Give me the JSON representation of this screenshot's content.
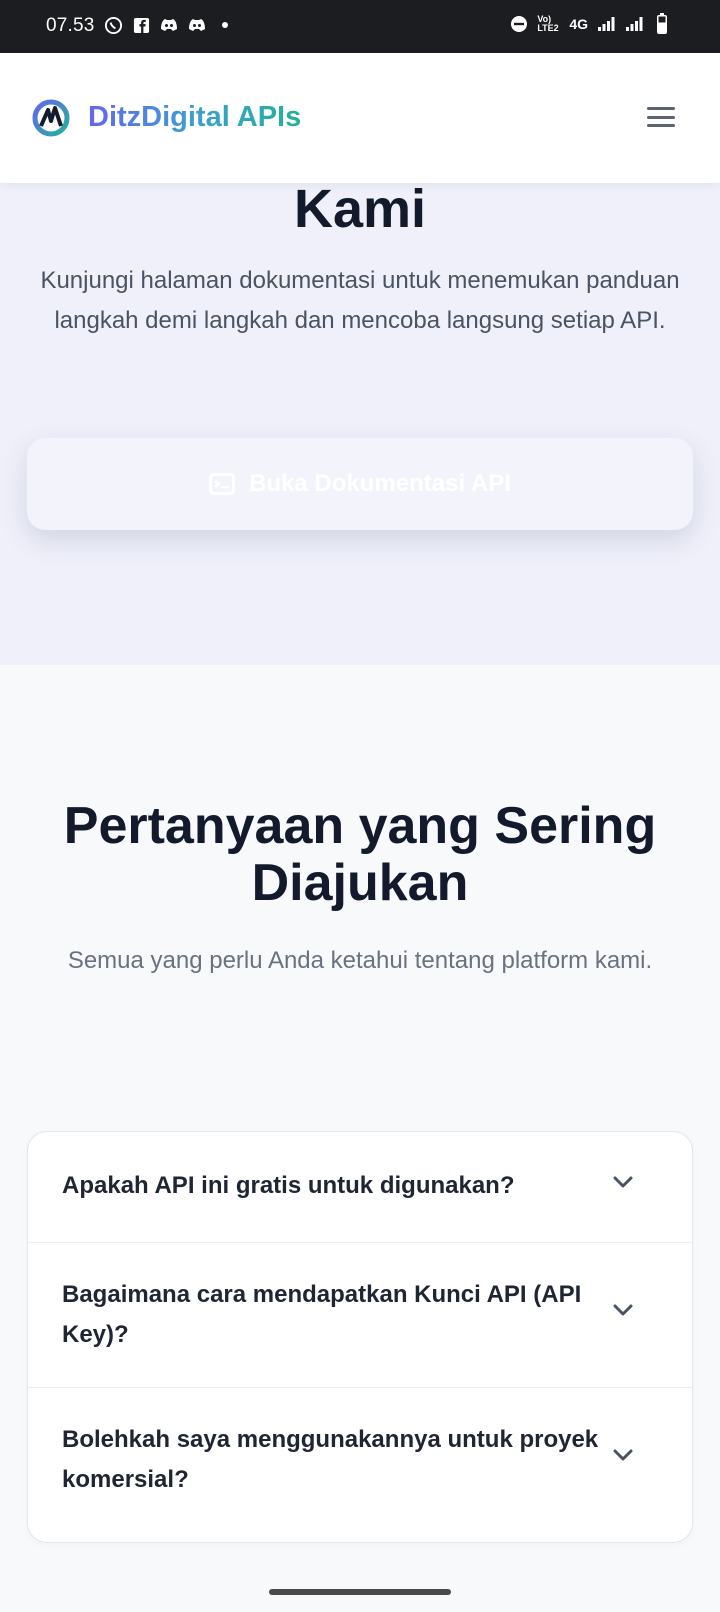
{
  "status_bar": {
    "time": "07.53",
    "network_type": "4G",
    "volte_label": "Vo) LTE2",
    "left_icons": [
      "whatsapp-icon",
      "facebook-icon",
      "discord-icon",
      "discord-icon",
      "dot-icon"
    ],
    "right_icons": [
      "do-not-disturb-icon",
      "volte-icon",
      "signal-icon",
      "signal-icon",
      "battery-icon"
    ]
  },
  "navbar": {
    "brand": "DitzDigital APIs",
    "logo_icon": "ditzdigital-logo-icon",
    "menu_icon": "hamburger-menu-icon",
    "brand_gradient": [
      "#6366f1",
      "#22b19a"
    ]
  },
  "hero": {
    "title_tail": "Kami",
    "description": "Kunjungi halaman dokumentasi untuk menemukan panduan langkah demi langkah dan mencoba langsung setiap API.",
    "button_label": "Buka Dokumentasi API",
    "button_icon": "terminal-icon"
  },
  "faq": {
    "title": "Pertanyaan yang Sering Diajukan",
    "subtitle": "Semua yang perlu Anda ketahui tentang platform kami.",
    "items": [
      {
        "question": "Apakah API ini gratis untuk digunakan?"
      },
      {
        "question": "Bagaimana cara mendapatkan Kunci API (API Key)?"
      },
      {
        "question": "Bolehkah saya menggunakannya untuk proyek komersial?"
      }
    ]
  },
  "colors": {
    "heading": "#131a2b",
    "hero_bg": "#eff0f9",
    "page_bg": "#f8f9fb",
    "status_bar_bg": "#1c1d20"
  }
}
